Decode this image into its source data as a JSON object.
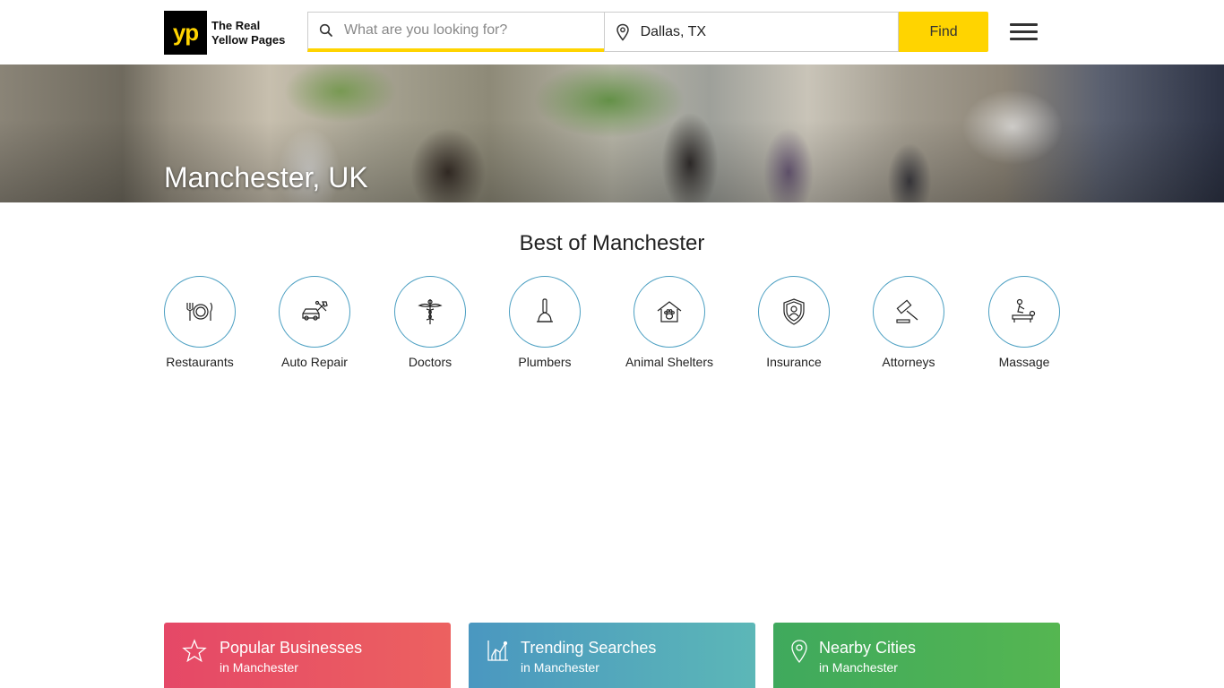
{
  "header": {
    "logo_mark": "yp",
    "logo_line1": "The Real",
    "logo_line2": "Yellow Pages",
    "search_placeholder": "What are you looking for?",
    "search_value": "",
    "location_value": "Dallas, TX",
    "find_label": "Find"
  },
  "hero": {
    "title": "Manchester, UK"
  },
  "best": {
    "title": "Best of Manchester",
    "categories": [
      {
        "label": "Restaurants",
        "icon": "restaurant-icon"
      },
      {
        "label": "Auto Repair",
        "icon": "auto-repair-icon"
      },
      {
        "label": "Doctors",
        "icon": "doctor-icon"
      },
      {
        "label": "Plumbers",
        "icon": "plunger-icon"
      },
      {
        "label": "Animal Shelters",
        "icon": "animal-shelter-icon"
      },
      {
        "label": "Insurance",
        "icon": "insurance-icon"
      },
      {
        "label": "Attorneys",
        "icon": "gavel-icon"
      },
      {
        "label": "Massage",
        "icon": "massage-icon"
      }
    ]
  },
  "cards": [
    {
      "title": "Popular Businesses",
      "sub": "in Manchester",
      "icon": "star-icon",
      "color": "#e54867"
    },
    {
      "title": "Trending Searches",
      "sub": "in Manchester",
      "icon": "trend-chart-icon",
      "color": "#4a97c0"
    },
    {
      "title": "Nearby Cities",
      "sub": "in Manchester",
      "icon": "map-pin-icon",
      "color": "#3fa95d"
    }
  ],
  "colors": {
    "accent_yellow": "#ffd400",
    "circle_border": "#4b9fc2"
  }
}
